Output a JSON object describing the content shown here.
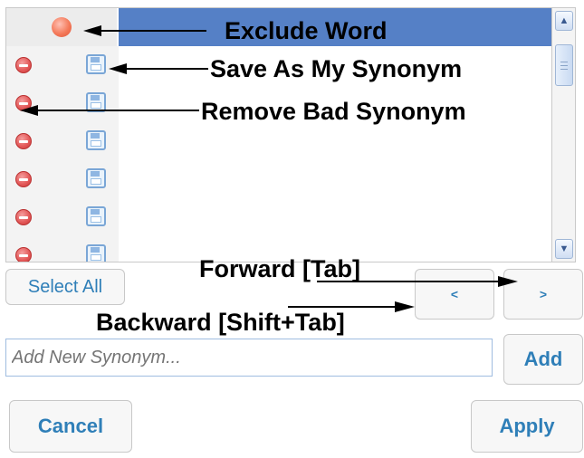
{
  "grid": {
    "rows": [
      {
        "remove_icon": "remove-icon",
        "save_icon": "save-icon"
      },
      {
        "remove_icon": "remove-icon",
        "save_icon": "save-icon"
      },
      {
        "remove_icon": "remove-icon",
        "save_icon": "save-icon"
      },
      {
        "remove_icon": "remove-icon",
        "save_icon": "save-icon"
      },
      {
        "remove_icon": "remove-icon",
        "save_icon": "save-icon"
      },
      {
        "remove_icon": "remove-icon",
        "save_icon": "save-icon"
      }
    ],
    "header_icon": "exclude-icon",
    "header_color": "#5580c6"
  },
  "scrollbar": {
    "up_icon": "chevron-up-icon",
    "down_icon": "chevron-down-icon"
  },
  "controls": {
    "select_all": "Select All",
    "prev": "<",
    "next": ">",
    "synonym_placeholder": "Add New Synonym...",
    "add": "Add",
    "cancel": "Cancel",
    "apply": "Apply",
    "accent_color": "#2f7fb8"
  },
  "annotations": {
    "exclude_word": "Exclude Word",
    "save_as_synonym": "Save As My Synonym",
    "remove_bad_synonym": "Remove Bad Synonym",
    "forward": "Forward [Tab]",
    "backward": "Backward [Shift+Tab]"
  }
}
